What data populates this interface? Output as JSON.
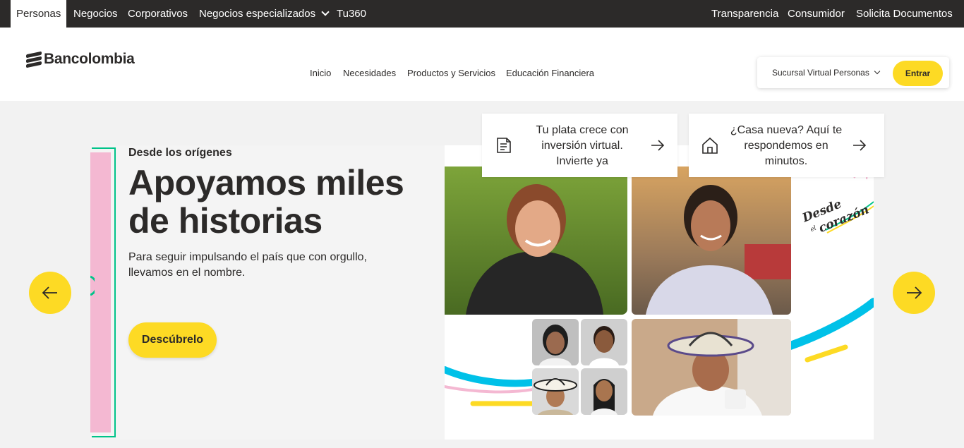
{
  "topbar": {
    "segments": [
      "Personas",
      "Negocios",
      "Corporativos",
      "Negocios especializados",
      "Tu360"
    ],
    "links": [
      "Transparencia",
      "Consumidor",
      "Solicita Documentos"
    ]
  },
  "header": {
    "brand": "Bancolombia",
    "nav": [
      "Inicio",
      "Necesidades",
      "Productos y Servicios",
      "Educación Financiera"
    ],
    "login": {
      "select_value": "Sucursal Virtual Personas",
      "button": "Entrar"
    }
  },
  "hero": {
    "eyebrow": "Desde los orígenes",
    "headline": "Apoyamos miles de historias",
    "subcopy": "Para seguir impulsando el país que con orgullo, llevamos en el nombre.",
    "cta": "Descúbrelo",
    "campaign_mark": [
      "Desde",
      "el",
      "corazón"
    ]
  },
  "feature_cards": [
    {
      "text": "Tu plata crece con inversión virtual. Invierte ya",
      "icon": "document-icon"
    },
    {
      "text": "¿Casa nueva? Aquí te respondemos en minutos.",
      "icon": "house-icon"
    }
  ],
  "colors": {
    "accent_yellow": "#fdda24",
    "dark": "#2c2a29",
    "pink": "#f4b8d2",
    "green": "#00c389",
    "cyan": "#00c1e8"
  }
}
